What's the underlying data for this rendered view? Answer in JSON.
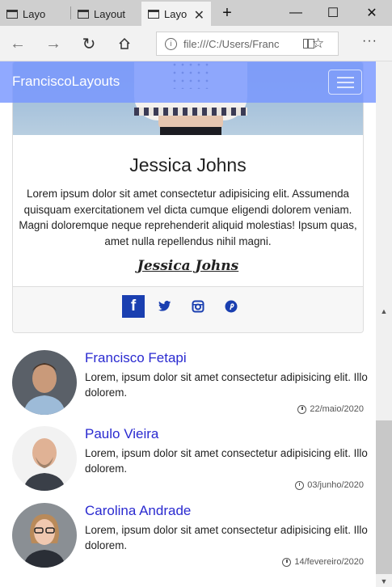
{
  "browser": {
    "tabs": [
      {
        "label": "Layo"
      },
      {
        "label": "Layout"
      },
      {
        "label": "Layo"
      }
    ],
    "new_tab": "+",
    "url": "file:///C:/Users/Franc"
  },
  "navbar": {
    "brand": "FranciscoLayouts"
  },
  "card": {
    "title": "Jessica Johns",
    "text": "Lorem ipsum dolor sit amet consectetur adipisicing elit. Assumenda quisquam exercitationem vel dicta cumque eligendi dolorem veniam. Magni doloremque neque reprehenderit aliquid molestias! Ipsum quas, amet nulla repellendus nihil magni.",
    "signature": "Jessica Johns",
    "social": [
      "facebook-icon",
      "twitter-icon",
      "instagram-icon",
      "pinterest-icon"
    ]
  },
  "people": [
    {
      "name": "Francisco Fetapi",
      "text": "Lorem, ipsum dolor sit amet consectetur adipisicing elit. Illo dolorem.",
      "date": "22/maio/2020"
    },
    {
      "name": "Paulo Vieira",
      "text": "Lorem, ipsum dolor sit amet consectetur adipisicing elit. Illo dolorem.",
      "date": "03/junho/2020"
    },
    {
      "name": "Carolina Andrade",
      "text": "Lorem, ipsum dolor sit amet consectetur adipisicing elit. Illo dolorem.",
      "date": "14/fevereiro/2020"
    }
  ],
  "colors": {
    "navbar": "#7896ff",
    "link": "#2a2ad0",
    "social": "#1a3fb0"
  }
}
